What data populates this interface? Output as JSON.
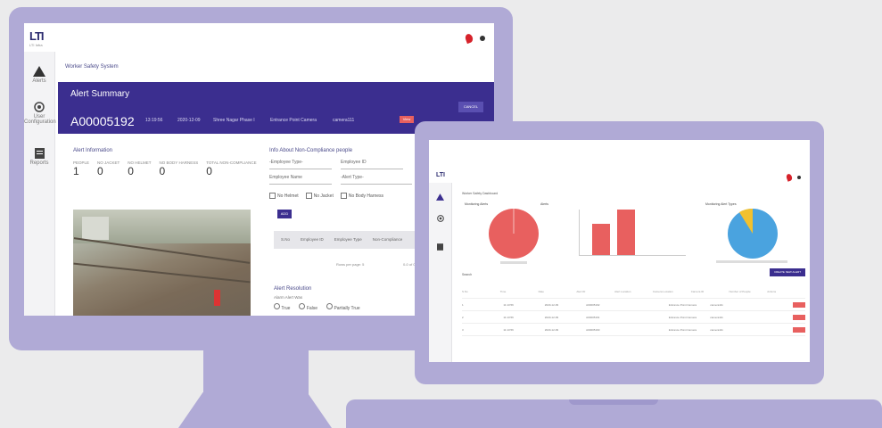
{
  "monitor_app": {
    "logo": {
      "text": "LTI",
      "sub": "LTI Infra"
    },
    "sidebar": [
      {
        "label": "Alerts",
        "icon": "warning-icon"
      },
      {
        "label": "User Configuration",
        "icon": "user-config-icon"
      },
      {
        "label": "Reports",
        "icon": "reports-icon"
      }
    ],
    "breadcrumb": "Worker Safety System",
    "alert_summary": {
      "title": "Alert Summary",
      "alert_id": "A00005192",
      "time": "13:19:56",
      "date": "2020-12-09",
      "site": "Shree Nagar Phase I",
      "camera_name": "Entrance Point Camera",
      "camera_id": "camera111",
      "cancel_label": "CANCEL",
      "view_label": "View"
    },
    "alert_information": {
      "title": "Alert Information",
      "stats": [
        {
          "label": "PEOPLE",
          "value": "1"
        },
        {
          "label": "NO JACKET",
          "value": "0"
        },
        {
          "label": "NO HELMET",
          "value": "0"
        },
        {
          "label": "NO BODY HARNESS",
          "value": "0"
        },
        {
          "label": "TOTAL NON-COMPLIANCE",
          "value": "0"
        }
      ]
    },
    "non_compliance": {
      "title": "Info About Non-Compliance people",
      "employee_type": "-Employee Type-",
      "employee_id": "Employee ID",
      "employee_name": "Employee Name",
      "alert_type": "-Alert Type-",
      "checks": [
        "No Helmet",
        "No Jacket",
        "No Body Harness"
      ],
      "add_label": "ADD",
      "table_headers": [
        "S.No",
        "Employee ID",
        "Employee Type",
        "Non-Compliance"
      ],
      "rows_per_page": "Rows per page: 5",
      "page_info": "0-0 of 0"
    },
    "alert_resolution": {
      "title": "Alert Resolution",
      "prompt": "Alarm Alert Was",
      "options": [
        "True",
        "False",
        "Partially True"
      ]
    }
  },
  "laptop_app": {
    "logo": "LTI",
    "breadcrumb": "Worker Safety Dashboard",
    "cards": [
      {
        "title": "Monitoring Alerts"
      },
      {
        "title": "Alerts"
      },
      {
        "title": "Monitoring Alert Types"
      }
    ],
    "search_label": "Search",
    "action_button": "CREATE NEW ALERT",
    "table_headers": [
      "S.No",
      "Time",
      "Date",
      "Alert ID",
      "Alert Location",
      "Camera Location",
      "Camera ID",
      "Number of People",
      "Actions"
    ],
    "table_rows": [
      [
        "1",
        "11:13:56",
        "2020-12-09",
        "A00005192",
        "",
        "Entrance Point Camera",
        "camera111",
        "",
        ""
      ],
      [
        "2",
        "11:13:56",
        "2020-12-09",
        "A00005191",
        "",
        "Entrance Point Camera",
        "camera111",
        "",
        ""
      ],
      [
        "3",
        "11:13:56",
        "2020-12-09",
        "A00005190",
        "",
        "Entrance Point Camera",
        "camera111",
        "",
        ""
      ]
    ]
  },
  "colors": {
    "device_frame": "#b0aad6",
    "banner": "#3b2e8f",
    "alert_red": "#e8605f",
    "pie_blue": "#4aa3df",
    "pie_yellow": "#f2c12e"
  }
}
